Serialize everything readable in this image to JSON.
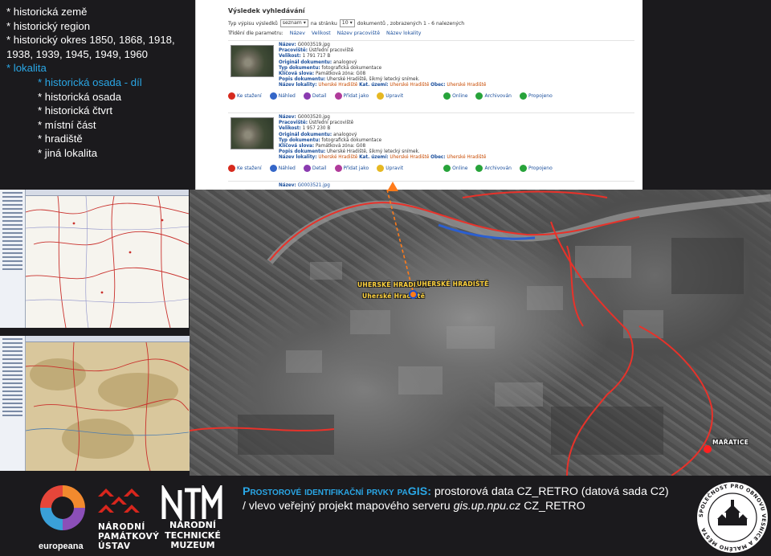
{
  "categories": {
    "items": [
      {
        "text": "* historická země",
        "level": 0,
        "accent": false
      },
      {
        "text": "* historický region",
        "level": 0,
        "accent": false
      },
      {
        "text": "* historický okres 1850, 1868, 1918, 1938, 1939, 1945, 1949, 1960",
        "level": 0,
        "accent": false
      },
      {
        "text": "* lokalita",
        "level": 0,
        "accent": true
      },
      {
        "text": "* historická osada - díl",
        "level": 1,
        "accent": true
      },
      {
        "text": "* historická osada",
        "level": 1,
        "accent": false
      },
      {
        "text": "* historická čtvrt",
        "level": 1,
        "accent": false
      },
      {
        "text": "* místní část",
        "level": 1,
        "accent": false
      },
      {
        "text": "* hradiště",
        "level": 1,
        "accent": false
      },
      {
        "text": "* jiná lokalita",
        "level": 1,
        "accent": false
      }
    ]
  },
  "results": {
    "title": "Výsledek vyhledávání",
    "type_label": "Typ výpisu výsledků",
    "type_value": "seznam",
    "page_label": "na stránku",
    "page_value": "10",
    "count_text": "dokumentů , zobrazených 1 - 6 nalezených",
    "sort_label": "Třídění dle parametru:",
    "sort_items": [
      "Název",
      "Velikost",
      "Název pracoviště",
      "Název lokality"
    ],
    "records": [
      {
        "name": "G0003519.jpg",
        "workplace": "Ústřední pracoviště",
        "size": "1 791 717 B",
        "original": "analogový",
        "doc_type": "fotografická dokumentace",
        "keywords": "Památková zóna: G08",
        "description": "Uherské Hradiště, šikmý letecký snímek.",
        "localities": "Uherské Hradiště",
        "cadastral": "Uherské Hradiště",
        "municipality": "Uherské Hradiště"
      },
      {
        "name": "G0003520.jpg",
        "workplace": "Ústřední pracoviště",
        "size": "1 957 230 B",
        "original": "analogový",
        "doc_type": "fotografická dokumentace",
        "keywords": "Památková zóna: G08",
        "description": "Uherské Hradiště, šikmý letecký snímek.",
        "localities": "Uherské Hradiště",
        "cadastral": "Uherské Hradiště",
        "municipality": "Uherské Hradiště"
      }
    ],
    "partial_record_name": "G0003521.jpg",
    "field_labels": {
      "name": "Název:",
      "workplace": "Pracoviště:",
      "size": "Velikost:",
      "original": "Originál dokumentu:",
      "doc_type": "Typ dokumentu:",
      "keywords": "Klíčová slova:",
      "description": "Popis dokumentu:",
      "localities": "Název lokality:",
      "cadastral": "Kat. území:",
      "municipality": "Obec:"
    },
    "actions": [
      "Ke stažení",
      "Náhled",
      "Detail",
      "Přidat jako",
      "Upravit",
      "Online",
      "Archivován",
      "Propojeno"
    ]
  },
  "map": {
    "labels": [
      "UHERSKÉ HRADIŠTĚ",
      "UHERSKÉ HRADIŠTĚ",
      "Uherské Hradiště",
      "MAŘATICE"
    ]
  },
  "caption": {
    "head_pre": "Prostorové identifikační prvky pa",
    "head_gis": "GIS:",
    "line1_rest": " prostorová data CZ_RETRO (datová sada C2)",
    "line2_pre": "/ vlevo veřejný projekt mapového serveru ",
    "line2_url": "gis.up.npu.cz",
    "line2_post": " CZ_RETRO"
  },
  "logos": {
    "europeana": "europeana",
    "npu": [
      "NÁRODNÍ",
      "PAMÁTKOVÝ",
      "ÚSTAV"
    ],
    "ntm": [
      "NÁRODNÍ",
      "TECHNICKÉ",
      "MUZEUM"
    ],
    "seal_text": "SPOLEČNOST PRO OBNOVU VESNICE A MALÉHO MĚSTA"
  },
  "colors": {
    "accent_blue": "#2aa7e6",
    "boundary_red": "#e8322a",
    "river_blue": "#2b5fd0",
    "marker_orange": "#ff7b1a"
  }
}
